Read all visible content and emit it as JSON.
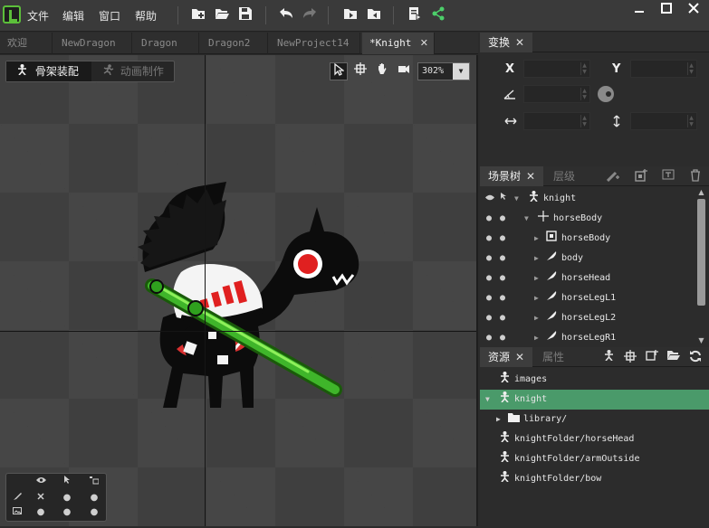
{
  "menu": {
    "file": "文件",
    "edit": "编辑",
    "window": "窗口",
    "help": "帮助"
  },
  "doc_tabs": [
    {
      "label": "欢迎",
      "active": false
    },
    {
      "label": "NewDragon",
      "active": false
    },
    {
      "label": "Dragon",
      "active": false
    },
    {
      "label": "Dragon2",
      "active": false
    },
    {
      "label": "NewProject14",
      "active": false
    },
    {
      "label": "*Knight",
      "active": true
    }
  ],
  "close_glyph": "✕",
  "viewport": {
    "mode_rig": "骨架装配",
    "mode_animate": "动画制作",
    "zoom": "302%"
  },
  "transform": {
    "tab": "变换",
    "x_label": "X",
    "y_label": "Y"
  },
  "scene_tree": {
    "tab_tree": "场景树",
    "tab_layer": "层级",
    "rows": [
      {
        "label": "knight",
        "icon": "armature-icon",
        "indent": 0
      },
      {
        "label": "horseBody",
        "icon": "bone-icon",
        "indent": 1
      },
      {
        "label": "horseBody",
        "icon": "bounding-box-icon",
        "indent": 2
      },
      {
        "label": "body",
        "icon": "slot-icon",
        "indent": 2
      },
      {
        "label": "horseHead",
        "icon": "slot-icon",
        "indent": 2
      },
      {
        "label": "horseLegL1",
        "icon": "slot-icon",
        "indent": 2
      },
      {
        "label": "horseLegL2",
        "icon": "slot-icon",
        "indent": 2
      },
      {
        "label": "horseLegR1",
        "icon": "slot-icon",
        "indent": 2
      }
    ]
  },
  "assets": {
    "tab_assets": "资源",
    "tab_props": "属性",
    "rows": [
      {
        "label": "images",
        "icon": "armature-icon",
        "selected": false
      },
      {
        "label": "knight",
        "icon": "armature-icon",
        "selected": true
      },
      {
        "label": "library/",
        "icon": "folder-icon",
        "selected": false
      },
      {
        "label": "knightFolder/horseHead",
        "icon": "armature-icon",
        "selected": false
      },
      {
        "label": "knightFolder/armOutside",
        "icon": "armature-icon",
        "selected": false
      },
      {
        "label": "knightFolder/bow",
        "icon": "armature-icon",
        "selected": false
      }
    ]
  },
  "colors": {
    "accent_green": "#4a9a6a",
    "logo_green": "#5cbf3a"
  }
}
